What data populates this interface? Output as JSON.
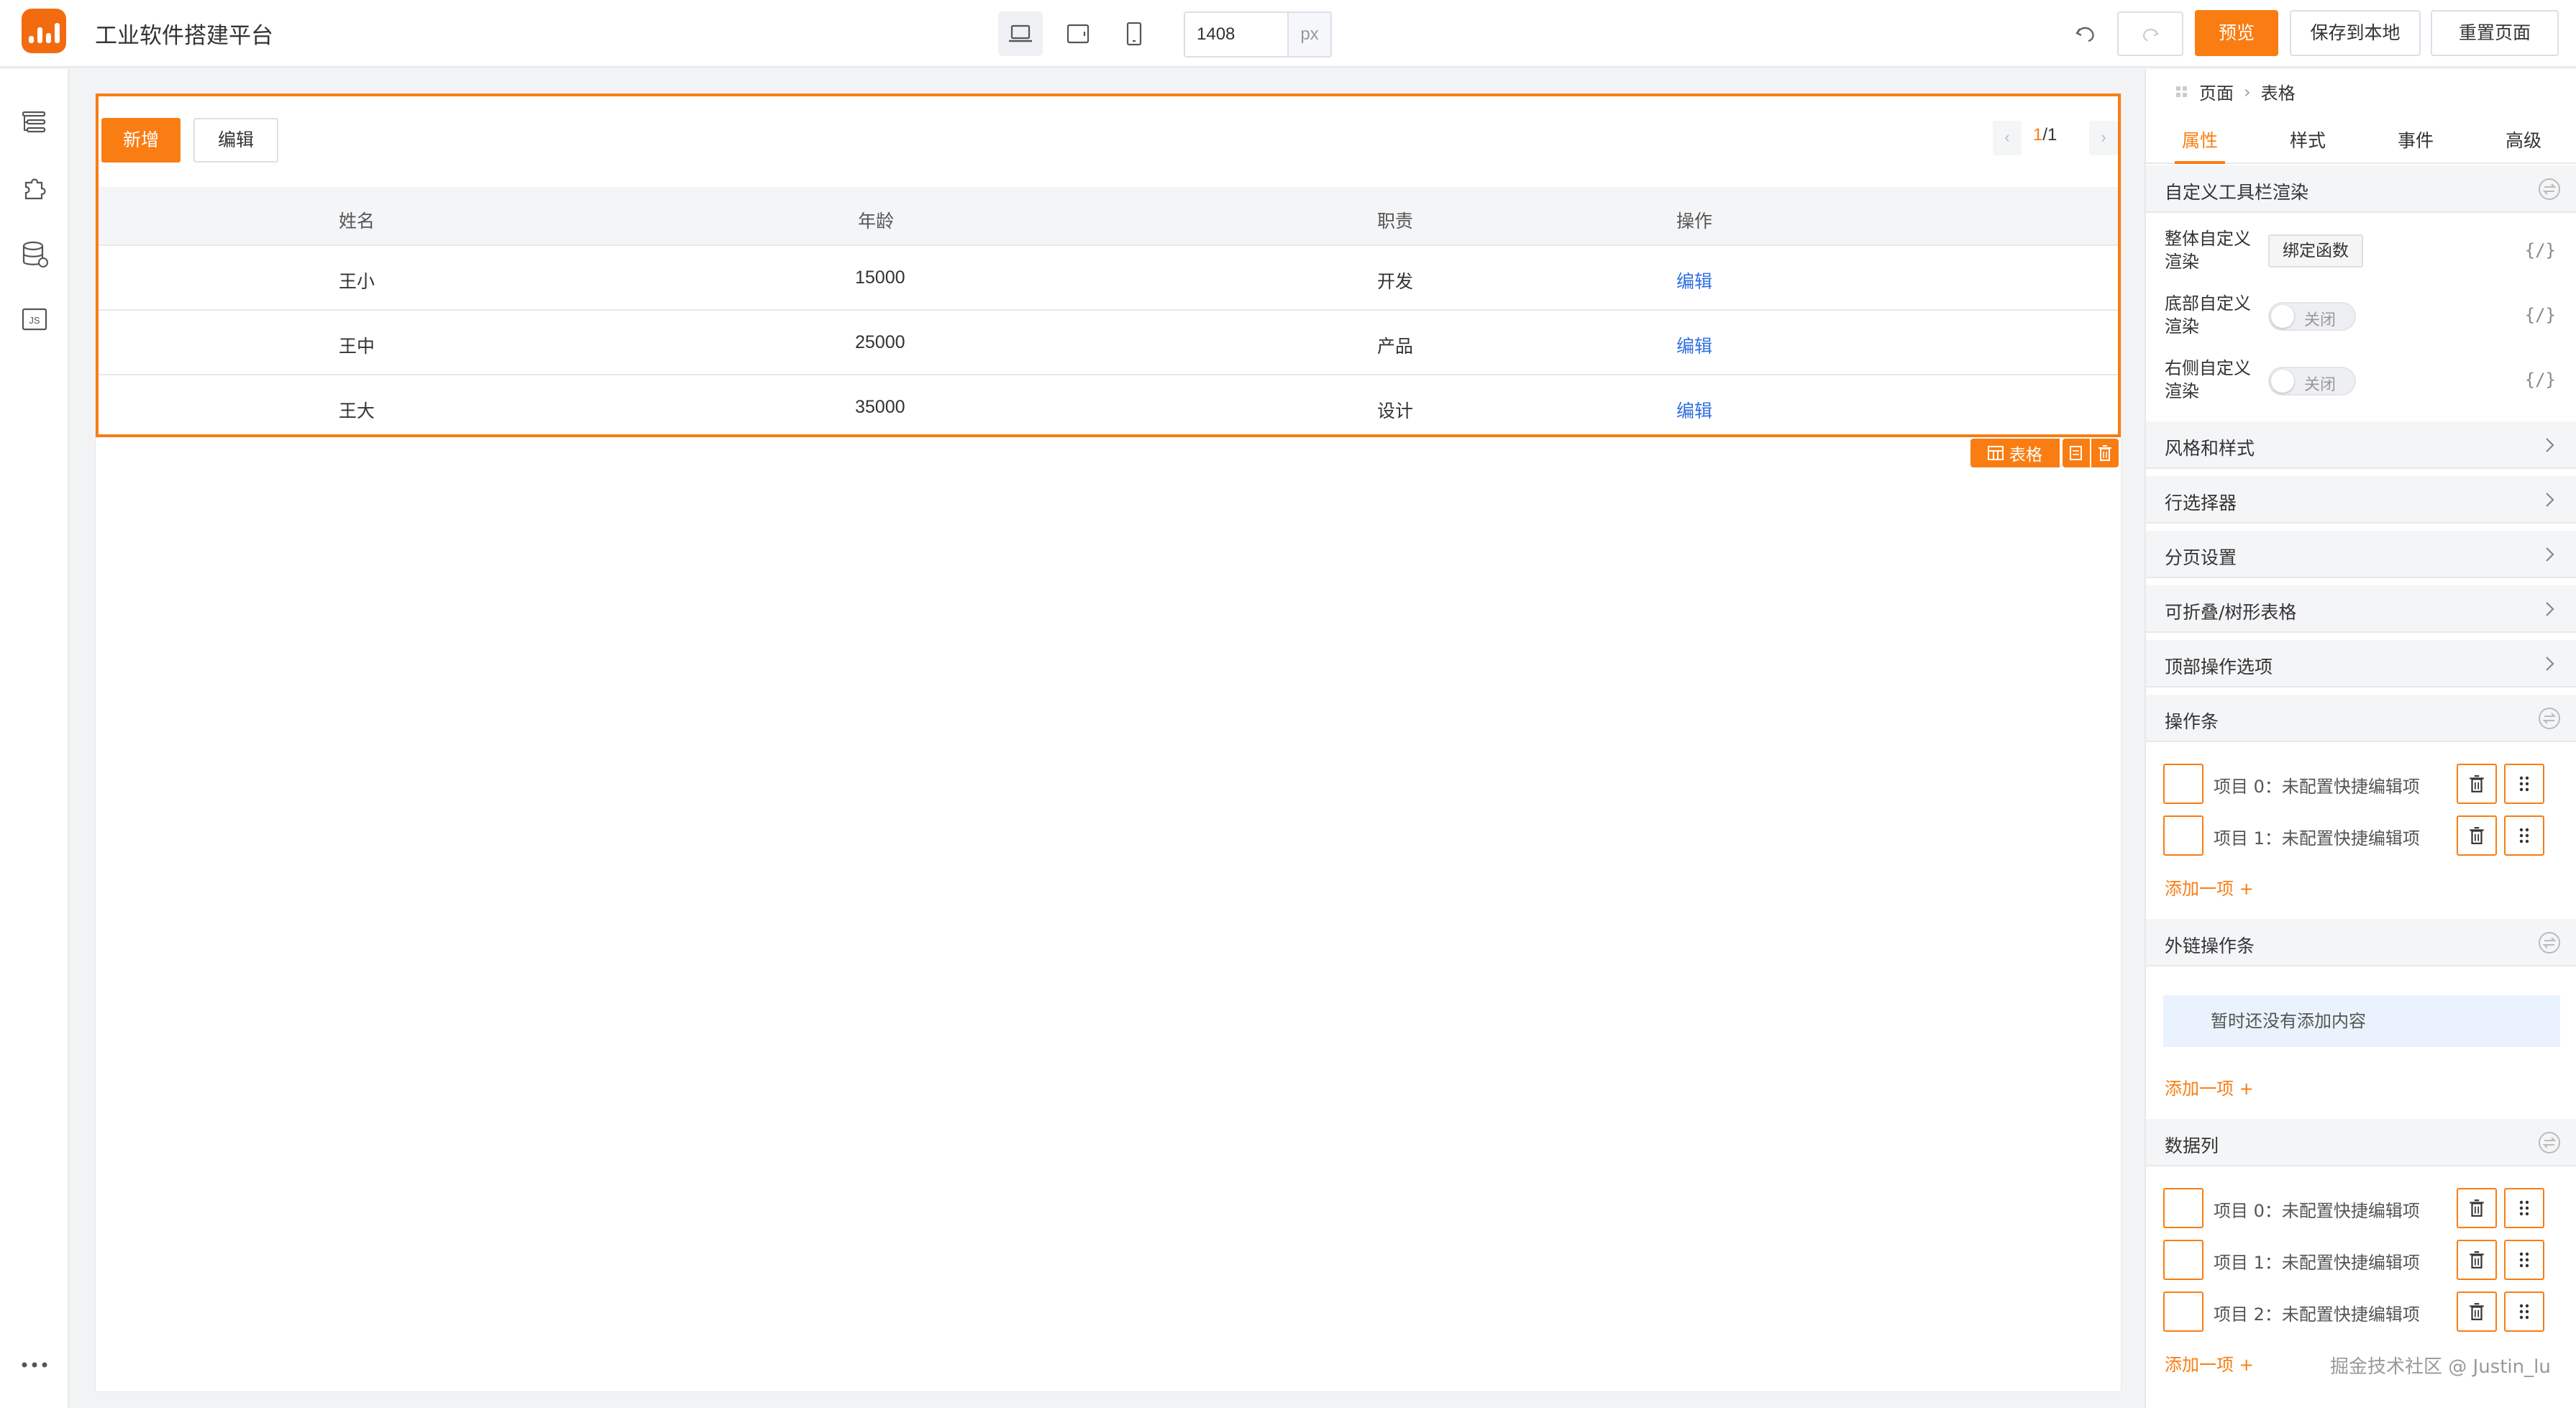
{
  "app": {
    "title": "工业软件搭建平台"
  },
  "toolbar": {
    "width_value": "1408",
    "width_unit": "px",
    "preview_label": "预览",
    "save_label": "保存到本地",
    "reset_label": "重置页面"
  },
  "colors": {
    "accent": "#f97d12",
    "link": "#2f6fe0",
    "panel_bg": "#f4f5f7",
    "empty_bg": "#eaf3fd"
  },
  "table": {
    "add_label": "新增",
    "edit_label": "编辑",
    "pagination": {
      "current": "1",
      "total": "/1"
    },
    "columns": [
      "姓名",
      "年龄",
      "职责",
      "操作"
    ],
    "rows": [
      {
        "name": "王小",
        "age": "15000",
        "role": "开发",
        "action": "编辑"
      },
      {
        "name": "王中",
        "age": "25000",
        "role": "产品",
        "action": "编辑"
      },
      {
        "name": "王大",
        "age": "35000",
        "role": "设计",
        "action": "编辑"
      }
    ],
    "component_tag": "表格"
  },
  "panel": {
    "breadcrumb": [
      "页面",
      "表格"
    ],
    "tabs": [
      "属性",
      "样式",
      "事件",
      "高级"
    ],
    "toolbar_section": {
      "title": "自定义工具栏渲染",
      "rows": [
        {
          "label": "整体自定义渲染",
          "control": "绑定函数"
        },
        {
          "label": "底部自定义渲染",
          "control": "关闭"
        },
        {
          "label": "右侧自定义渲染",
          "control": "关闭"
        }
      ],
      "code_icon": "{/}"
    },
    "collapsed_sections": [
      "风格和样式",
      "行选择器",
      "分页设置",
      "可折叠/树形表格",
      "顶部操作选项"
    ],
    "operation_bar": {
      "title": "操作条",
      "items": [
        "项目 0：未配置快捷编辑项",
        "项目 1：未配置快捷编辑项"
      ],
      "add_label": "添加一项 +"
    },
    "external_bar": {
      "title": "外链操作条",
      "empty_text": "暂时还没有添加内容",
      "add_label": "添加一项 +"
    },
    "data_columns": {
      "title": "数据列",
      "items": [
        "项目 0：未配置快捷编辑项",
        "项目 1：未配置快捷编辑项",
        "项目 2：未配置快捷编辑项"
      ],
      "add_label": "添加一项 +"
    }
  },
  "watermark": "掘金技术社区 @ Justin_lu"
}
